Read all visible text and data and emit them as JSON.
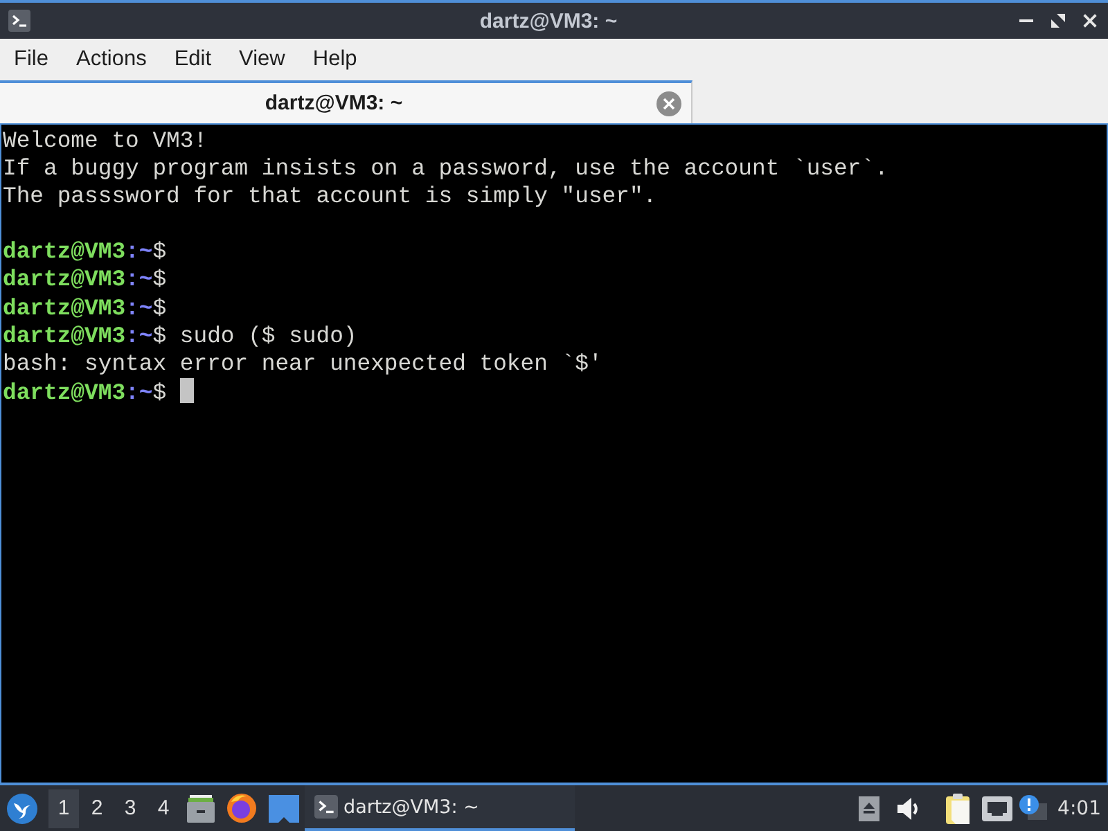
{
  "window": {
    "title": "dartz@VM3: ~"
  },
  "menu": [
    "File",
    "Actions",
    "Edit",
    "View",
    "Help"
  ],
  "tabs": [
    {
      "label": "dartz@VM3: ~",
      "selected": true
    }
  ],
  "terminal": {
    "lines": [
      {
        "kind": "output",
        "text": "Welcome to VM3!"
      },
      {
        "kind": "output",
        "text": "If a buggy program insists on a password, use the account `user`."
      },
      {
        "kind": "output",
        "text": "The passsword for that account is simply \"user\"."
      },
      {
        "kind": "blank"
      },
      {
        "kind": "prompt",
        "user_host": "dartz@VM3",
        "path": ":~",
        "symbol": "$",
        "cursor": false
      },
      {
        "kind": "prompt",
        "user_host": "dartz@VM3",
        "path": ":~",
        "symbol": "$",
        "cursor": false
      },
      {
        "kind": "prompt",
        "user_host": "dartz@VM3",
        "path": ":~",
        "symbol": "$",
        "cursor": false
      },
      {
        "kind": "prompt",
        "user_host": "dartz@VM3",
        "path": ":~",
        "symbol": "$",
        "command": "sudo ($ sudo)",
        "cursor": false
      },
      {
        "kind": "output",
        "text": "bash: syntax error near unexpected token `$'"
      },
      {
        "kind": "prompt",
        "user_host": "dartz@VM3",
        "path": ":~",
        "symbol": "$",
        "cursor": true
      }
    ]
  },
  "taskbar": {
    "workspaces": [
      {
        "label": "1",
        "selected": true
      },
      {
        "label": "2",
        "selected": false
      },
      {
        "label": "3",
        "selected": false
      },
      {
        "label": "4",
        "selected": false
      }
    ],
    "tasks": [
      {
        "label": "dartz@VM3: ~",
        "selected": true
      }
    ],
    "clock": "4:01"
  }
}
